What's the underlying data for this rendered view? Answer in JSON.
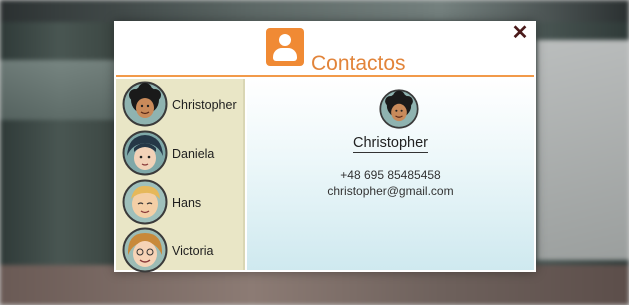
{
  "dialog": {
    "title": "Contactos",
    "header_icon": "contacts-person-icon",
    "close_label": "✕",
    "accent_color": "#f08a34"
  },
  "contacts": [
    {
      "name": "Christopher",
      "avatar": "avatar-christopher"
    },
    {
      "name": "Daniela",
      "avatar": "avatar-daniela"
    },
    {
      "name": "Hans",
      "avatar": "avatar-hans"
    },
    {
      "name": "Victoria",
      "avatar": "avatar-victoria"
    }
  ],
  "selected": {
    "name": "Christopher",
    "phone": "+48 695 85485458",
    "email": "christopher@gmail.com"
  }
}
